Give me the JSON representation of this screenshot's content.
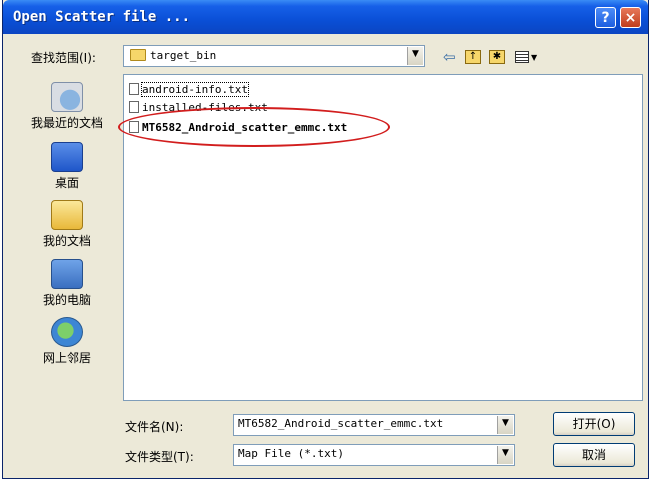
{
  "window": {
    "title": "Open Scatter file ...",
    "help_label": "?",
    "close_label": "×"
  },
  "lookin": {
    "label": "查找范围(I):",
    "value": "target_bin"
  },
  "toolbar_icons": [
    "back-arrow-icon",
    "up-folder-icon",
    "new-folder-icon",
    "view-menu-icon"
  ],
  "places": [
    {
      "label": "我最近的文档",
      "icon": "recent-documents-icon"
    },
    {
      "label": "桌面",
      "icon": "desktop-icon"
    },
    {
      "label": "我的文档",
      "icon": "my-documents-icon"
    },
    {
      "label": "我的电脑",
      "icon": "my-computer-icon"
    },
    {
      "label": "网上邻居",
      "icon": "network-places-icon"
    }
  ],
  "files": [
    {
      "name": "android-info.txt"
    },
    {
      "name": "installed-files.txt"
    },
    {
      "name": "MT6582_Android_scatter_emmc.txt"
    }
  ],
  "filename": {
    "label": "文件名(N):",
    "value": "MT6582_Android_scatter_emmc.txt"
  },
  "filetype": {
    "label": "文件类型(T):",
    "value": "Map File (*.txt)"
  },
  "buttons": {
    "open": "打开(O)",
    "cancel": "取消"
  },
  "colors": {
    "titlebar": "#0a4fd6",
    "dialog_bg": "#ece9d8",
    "annotation": "#d21d1d"
  }
}
